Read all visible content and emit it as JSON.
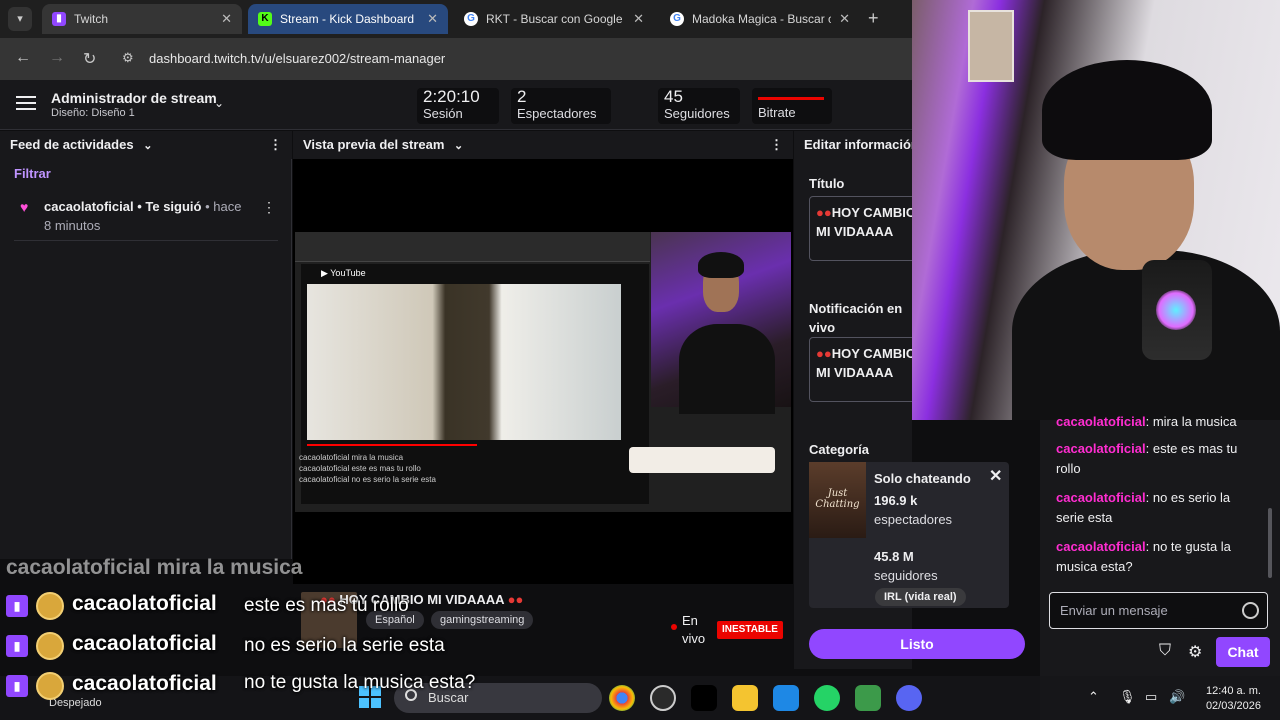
{
  "browser": {
    "tabs": [
      {
        "label": "Twitch",
        "state": "active"
      },
      {
        "label": "Stream - Kick Dashboard",
        "state": "hover"
      },
      {
        "label": "RKT - Buscar con Google",
        "state": "normal"
      },
      {
        "label": "Madoka Magica - Buscar con Google",
        "state": "normal"
      }
    ],
    "url": "dashboard.twitch.tv/u/elsuarez002/stream-manager"
  },
  "header": {
    "title": "Administrador de stream",
    "subtitle": "Diseño: Diseño 1",
    "stats": {
      "session_value": "2:20:10",
      "session_label": "Sesión",
      "viewers_value": "2",
      "viewers_label": "Espectadores",
      "followers_value": "45",
      "followers_label": "Seguidores",
      "bitrate_label": "Bitrate"
    }
  },
  "activity_feed": {
    "title": "Feed de actividades",
    "filter": "Filtrar",
    "item_user": "cacaolatoficial",
    "item_action": " • Te siguió",
    "item_time": " • hace 8 minutos"
  },
  "preview": {
    "title": "Vista previa del stream",
    "stream_title": "HOY CAMBIO MI VIDAAAA",
    "tags": [
      "Español",
      "gamingstreaming"
    ],
    "live_label": "En vivo",
    "status_badge": "INESTABLE",
    "mini_chat": [
      "cacaolatoficial mira la musica",
      "cacaolatoficial este es mas tu rollo",
      "cacaolatoficial no es serio la serie esta"
    ]
  },
  "edit_panel": {
    "title": "Editar información",
    "title_label": "Título",
    "title_value": "HOY CAMBIO MI VIDAAAA",
    "notification_label": "Notificación en vivo",
    "notification_value": "HOY CAMBIO MI VIDAAAA",
    "category_label": "Categoría",
    "category": {
      "name": "Solo chateando",
      "viewers_value": "196.9 k",
      "viewers_unit": "espectadores",
      "followers_value": "45.8 M",
      "followers_unit": "seguidores",
      "tag": "IRL (vida real)"
    },
    "done_button": "Listo"
  },
  "chat": {
    "messages": [
      {
        "user": "cacaolatoficial",
        "text": "mira la musica"
      },
      {
        "user": "cacaolatoficial",
        "text": "este es mas tu rollo"
      },
      {
        "user": "cacaolatoficial",
        "text": "no es serio la serie esta"
      },
      {
        "user": "cacaolatoficial",
        "text": "no te gusta la musica esta?"
      }
    ],
    "input_placeholder": "Enviar un mensaje",
    "chat_button": "Chat"
  },
  "stream_overlay": {
    "faded_line": "cacaolatoficial   mira la musica",
    "messages": [
      {
        "user": "cacaolatoficial",
        "text": "este es mas tu rollo"
      },
      {
        "user": "cacaolatoficial",
        "text": "no es serio la serie esta"
      },
      {
        "user": "cacaolatoficial",
        "text": "no te gusta la musica esta?"
      }
    ]
  },
  "taskbar": {
    "weather": "Despejado",
    "search_placeholder": "Buscar",
    "time": "12:40 a. m.",
    "date": "02/03/2026"
  },
  "colors": {
    "twitch_purple": "#9147ff",
    "chat_user": "#ff2dd1",
    "live_red": "#eb0400"
  }
}
